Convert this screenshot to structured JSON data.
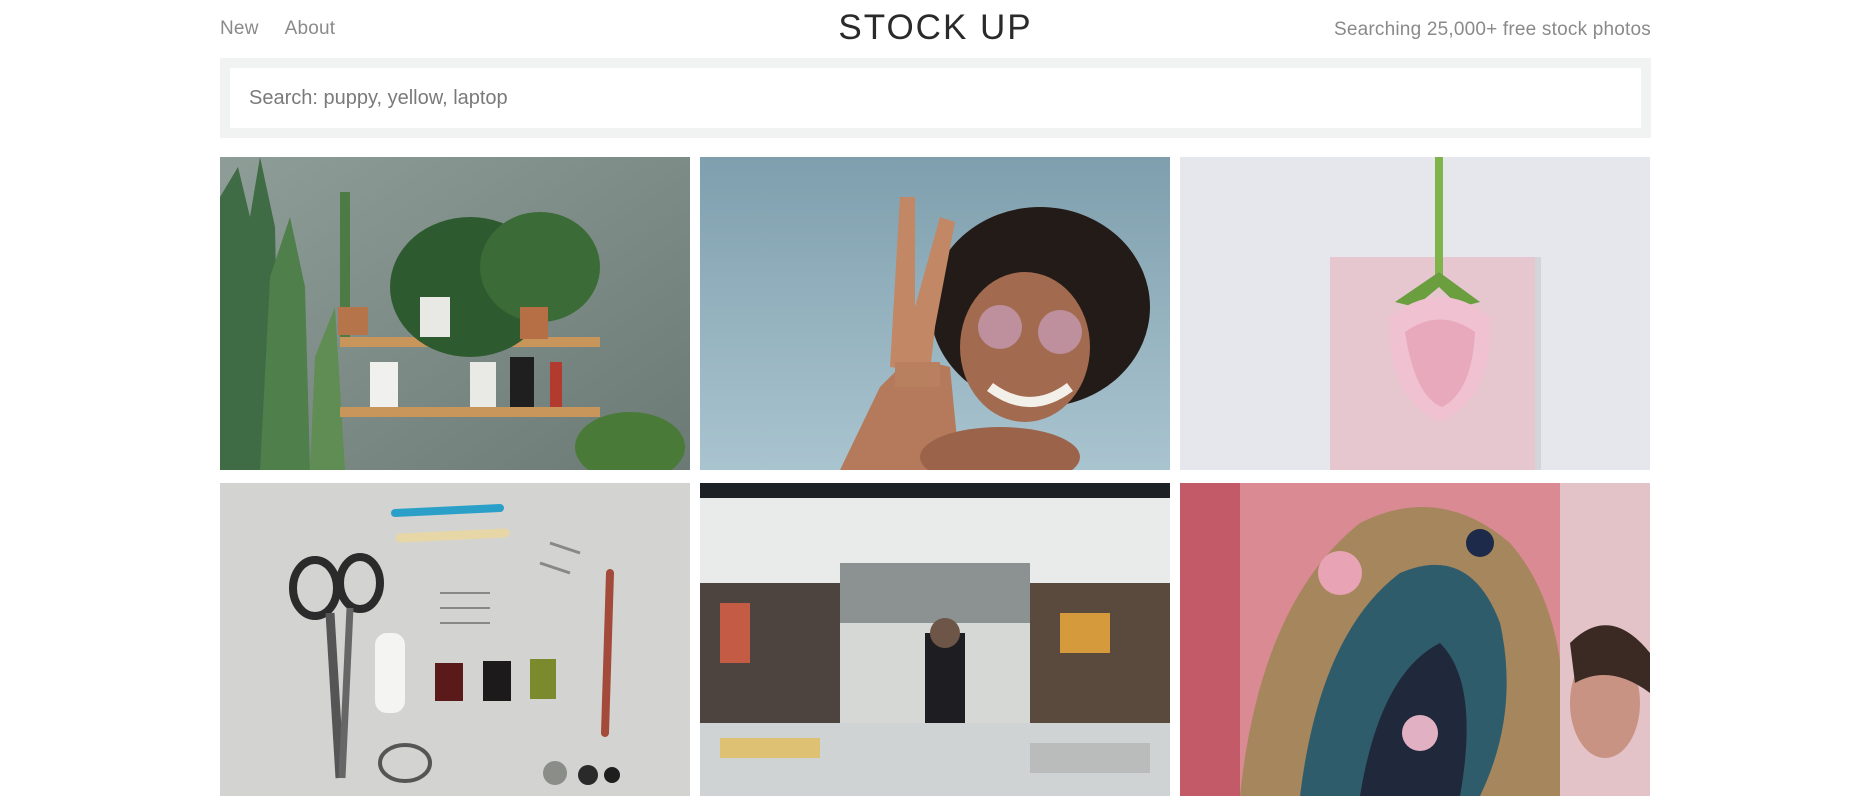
{
  "nav": {
    "new_label": "New",
    "about_label": "About"
  },
  "brand": {
    "logo_text": "STOCK UP",
    "tagline": "Searching 25,000+ free stock photos"
  },
  "search": {
    "placeholder": "Search: puppy, yellow, laptop",
    "value": ""
  },
  "photos": [
    {
      "subject": "houseplants-on-shelf"
    },
    {
      "subject": "woman-peace-sign"
    },
    {
      "subject": "pink-rose-on-card"
    },
    {
      "subject": "sewing-tools-flatlay"
    },
    {
      "subject": "restaurant-kitchen"
    },
    {
      "subject": "ornate-festival-costume"
    }
  ],
  "colors": {
    "search_bg": "#f1f3f2",
    "nav_text": "#8a8a8a",
    "logo_text": "#2a2a2a"
  }
}
